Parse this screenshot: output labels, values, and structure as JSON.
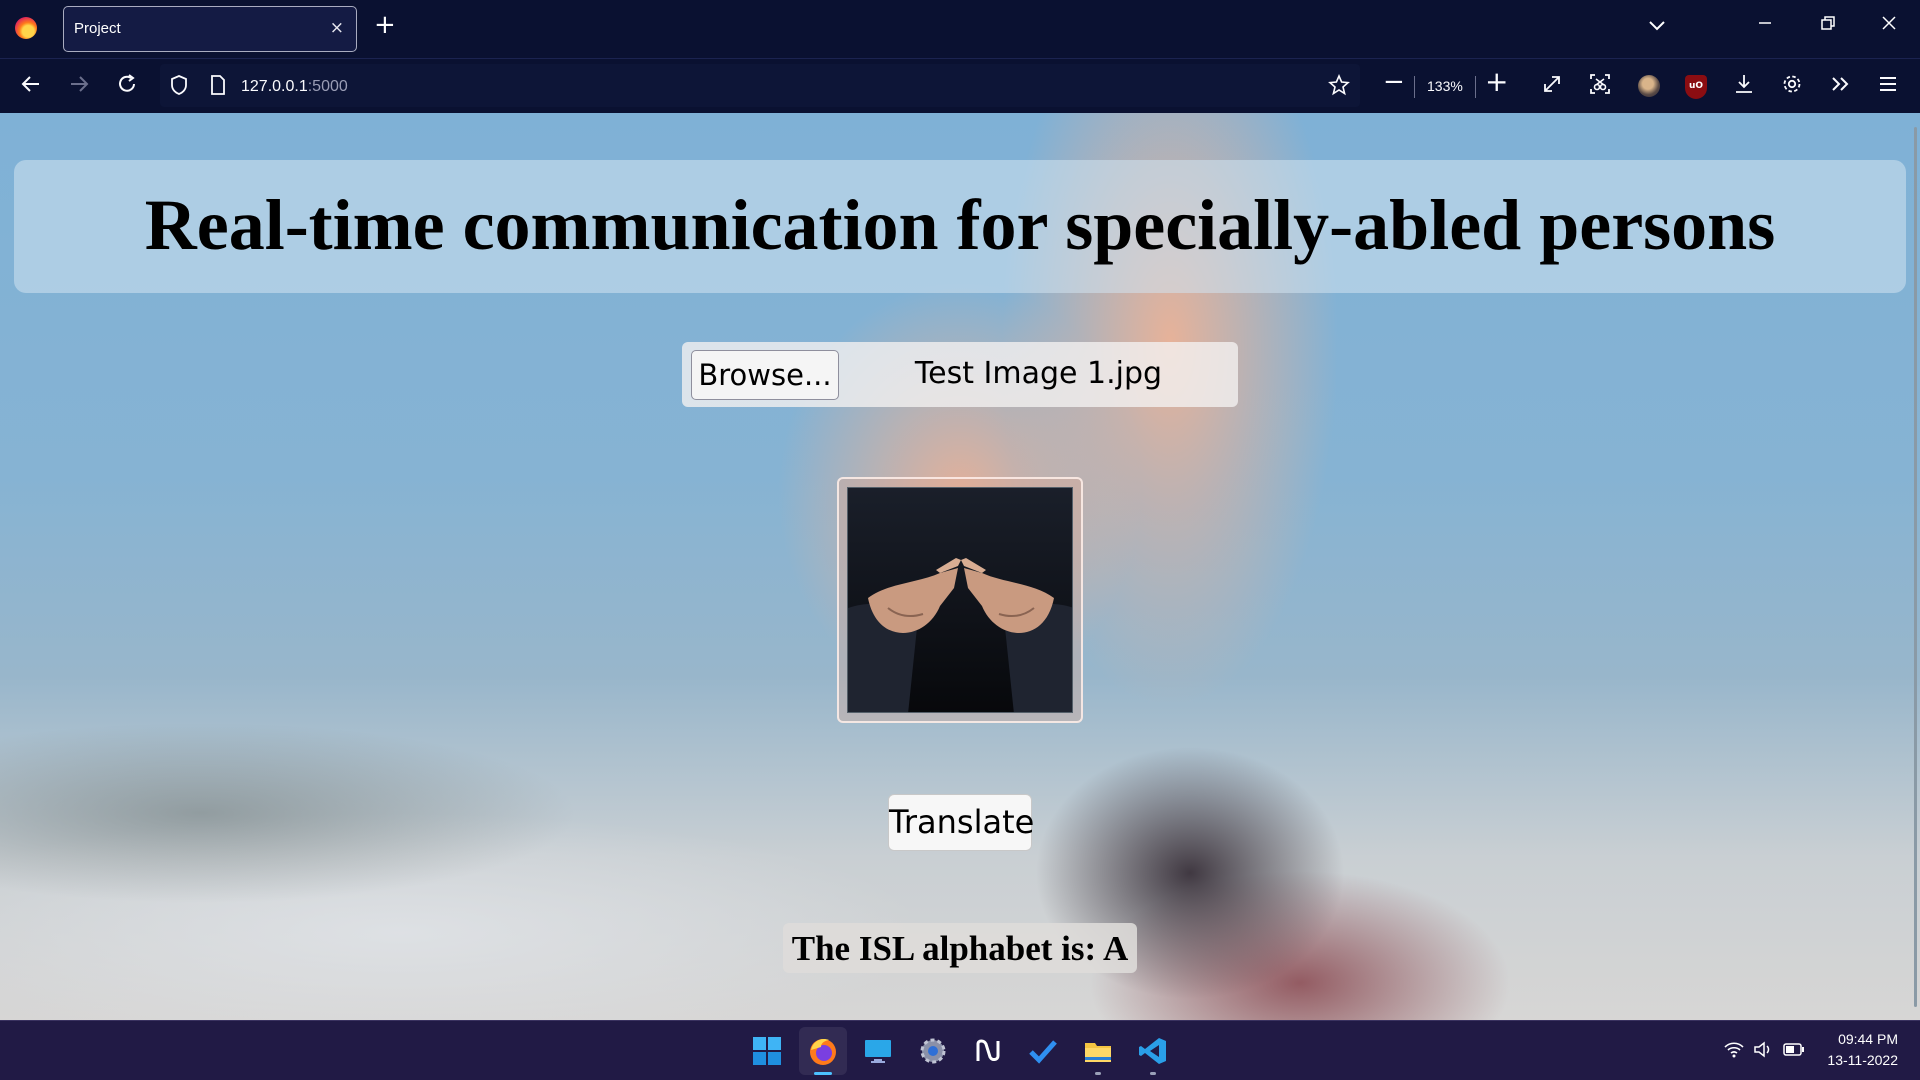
{
  "browser": {
    "tab_title": "Project",
    "tab_close": "×",
    "new_tab": "+",
    "url_host": "127.0.0.1",
    "url_port": ":5000",
    "zoom_level": "133%",
    "zoom_out": "−",
    "zoom_in": "+"
  },
  "page": {
    "title": "Real-time communication for specially-abled persons",
    "browse_label": "Browse...",
    "file_name": "Test Image 1.jpg",
    "translate_label": "Translate",
    "result_text": "The ISL alphabet is: A"
  },
  "taskbar": {
    "time": "09:44 PM",
    "date": "13-11-2022"
  },
  "colors": {
    "chrome_bg": "#0a1131",
    "taskbar_bg": "#211a45",
    "accent": "#4cc2ff"
  },
  "icons": {
    "browser": [
      "firefox-icon",
      "back-icon",
      "forward-icon",
      "reload-icon",
      "shield-icon",
      "page-icon",
      "star-icon",
      "fullscreen-icon",
      "screenshot-icon",
      "avatar-extension-icon",
      "ublock-icon",
      "download-icon",
      "settings-icon",
      "overflow-icon",
      "menu-icon"
    ],
    "taskbar": [
      "windows-start-icon",
      "firefox-icon",
      "desktop-icon",
      "settings-icon",
      "notion-icon",
      "todo-icon",
      "file-explorer-icon",
      "vscode-icon",
      "wifi-icon",
      "volume-icon",
      "battery-icon"
    ]
  }
}
